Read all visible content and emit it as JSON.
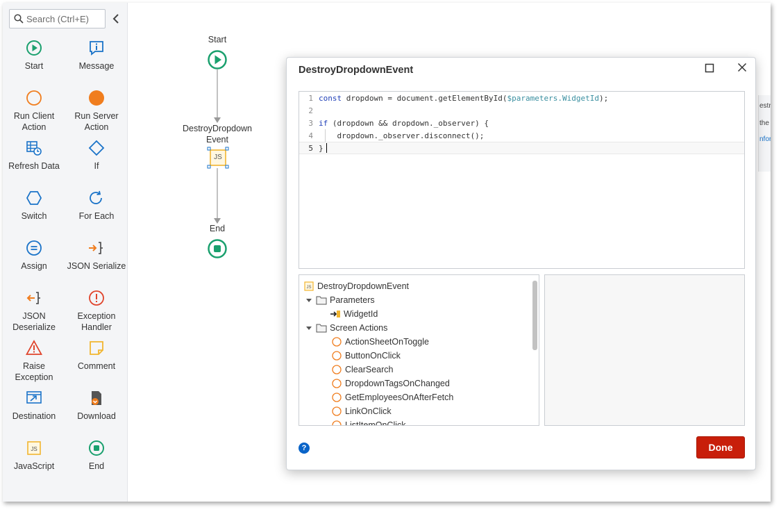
{
  "toolbox": {
    "search_placeholder": "Search (Ctrl+E)",
    "tools": [
      {
        "label": "Start",
        "icon": "start-icon"
      },
      {
        "label": "Message",
        "icon": "message-icon"
      },
      {
        "label": "Run Client Action",
        "icon": "run-client-action-icon"
      },
      {
        "label": "Run Server Action",
        "icon": "run-server-action-icon"
      },
      {
        "label": "Refresh Data",
        "icon": "refresh-data-icon"
      },
      {
        "label": "If",
        "icon": "if-icon"
      },
      {
        "label": "Switch",
        "icon": "switch-icon"
      },
      {
        "label": "For Each",
        "icon": "for-each-icon"
      },
      {
        "label": "Assign",
        "icon": "assign-icon"
      },
      {
        "label": "JSON Serialize",
        "icon": "json-serialize-icon"
      },
      {
        "label": "JSON Deserialize",
        "icon": "json-deserialize-icon"
      },
      {
        "label": "Exception Handler",
        "icon": "exception-handler-icon"
      },
      {
        "label": "Raise Exception",
        "icon": "raise-exception-icon"
      },
      {
        "label": "Comment",
        "icon": "comment-icon"
      },
      {
        "label": "Destination",
        "icon": "destination-icon"
      },
      {
        "label": "Download",
        "icon": "download-icon"
      },
      {
        "label": "JavaScript",
        "icon": "javascript-icon"
      },
      {
        "label": "End",
        "icon": "end-icon"
      }
    ]
  },
  "flow": {
    "start_label": "Start",
    "node_label_line1": "DestroyDropdown",
    "node_label_line2": "Event",
    "node_badge": "JS",
    "end_label": "End"
  },
  "dialog": {
    "title": "DestroyDropdownEvent",
    "code": {
      "line_numbers": [
        "1",
        "2",
        "3",
        "4",
        "5"
      ],
      "l1_kw": "const",
      "l1_a": " dropdown = document.getElementById(",
      "l1_param": "$parameters.WidgetId",
      "l1_b": ");",
      "l3_kw": "if",
      "l3_rest": " (dropdown && dropdown._observer) {",
      "l4": "    dropdown._observer.disconnect();",
      "l5": "}"
    },
    "tree": {
      "root": "DestroyDropdownEvent",
      "parameters_label": "Parameters",
      "parameter": "WidgetId",
      "screen_actions_label": "Screen Actions",
      "actions": [
        "ActionSheetOnToggle",
        "ButtonOnClick",
        "ClearSearch",
        "DropdownTagsOnChanged",
        "GetEmployeesOnAfterFetch",
        "LinkOnClick",
        "ListItemOnClick"
      ]
    },
    "help_label": "?",
    "done_label": "Done"
  },
  "behind_panel": {
    "line1": "estro",
    "line2": "the a",
    "line3": "nforr"
  },
  "colors": {
    "start_green": "#1aa06e",
    "action_orange": "#f07d1e",
    "server_orange": "#f07d1e",
    "info_blue": "#1a73c8",
    "error_red": "#e0442c",
    "comment_yellow": "#f2b630",
    "done_red": "#c81e0a"
  }
}
